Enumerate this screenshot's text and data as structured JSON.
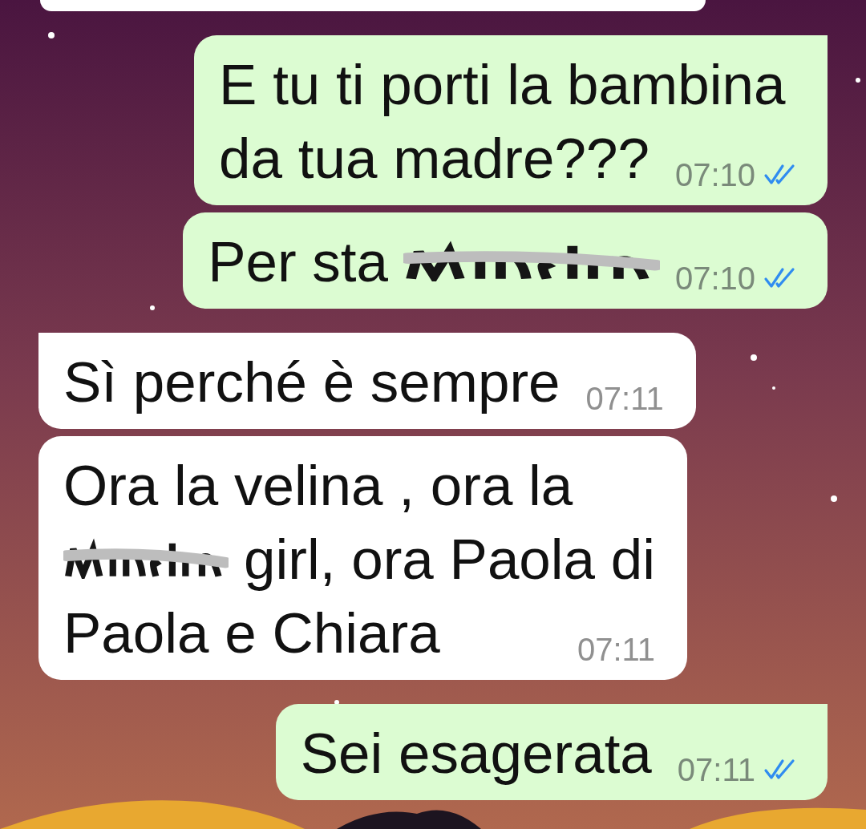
{
  "messages": [
    {
      "kind": "outgoing",
      "tail": true,
      "lines": [
        {
          "parts": [
            {
              "kind": "text",
              "text": "E tu ti porti la bambina"
            }
          ]
        },
        {
          "parts": [
            {
              "kind": "text",
              "text": "da tua madre???"
            }
          ]
        }
      ],
      "time": "07:10",
      "read": true
    },
    {
      "kind": "outgoing",
      "tail": false,
      "lines": [
        {
          "parts": [
            {
              "kind": "text",
              "text": "Per sta"
            },
            {
              "kind": "scribble-long"
            }
          ]
        }
      ],
      "time": "07:10",
      "read": true
    },
    {
      "kind": "incoming",
      "tail": true,
      "lines": [
        {
          "parts": [
            {
              "kind": "text",
              "text": "Sì perché è sempre"
            }
          ]
        }
      ],
      "time": "07:11"
    },
    {
      "kind": "incoming",
      "tail": false,
      "lines": [
        {
          "parts": [
            {
              "kind": "text",
              "text": "Ora la velina , ora la"
            }
          ]
        },
        {
          "parts": [
            {
              "kind": "scribble-short"
            },
            {
              "kind": "text",
              "text": "girl, ora Paola di"
            }
          ]
        },
        {
          "parts": [
            {
              "kind": "text",
              "text": "Paola e Chiara"
            }
          ]
        }
      ],
      "time": "07:11"
    },
    {
      "kind": "outgoing",
      "tail": true,
      "lines": [
        {
          "parts": [
            {
              "kind": "text",
              "text": "Sei esagerata"
            }
          ]
        }
      ],
      "time": "07:11",
      "read": true
    }
  ]
}
